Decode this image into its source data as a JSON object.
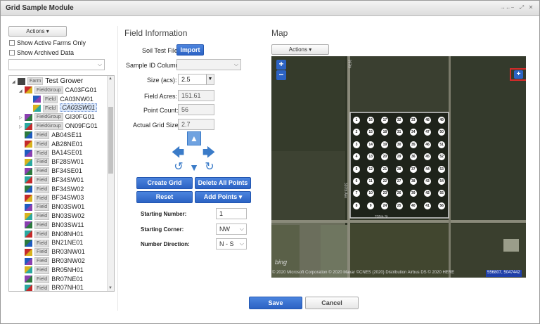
{
  "window": {
    "title": "Grid Sample Module",
    "controls": [
      "→←",
      "−",
      "⤢",
      "✕"
    ]
  },
  "left": {
    "actions_label": "Actions ▾",
    "show_active_farms": "Show Active Farms Only",
    "show_archived": "Show Archived Data",
    "tree": [
      {
        "toggle": "◢",
        "tag": "Farm",
        "label": "Test Grower",
        "indent": 14,
        "icon": "farm-icon"
      },
      {
        "toggle": "◢",
        "tag": "FieldGroup",
        "label": "CA03FG01",
        "indent": 24,
        "icon": "field-group-icon"
      },
      {
        "toggle": "",
        "tag": "Field",
        "label": "CA03NW01",
        "indent": 36,
        "icon": "field-icon"
      },
      {
        "toggle": "",
        "tag": "Field",
        "label": "CA03SW01",
        "indent": 36,
        "icon": "field-icon",
        "selected": true
      },
      {
        "toggle": "▷",
        "tag": "FieldGroup",
        "label": "GI30FG01",
        "indent": 24,
        "icon": "field-group-icon"
      },
      {
        "toggle": "▷",
        "tag": "FieldGroup",
        "label": "ON09FG01",
        "indent": 24,
        "icon": "field-group-icon"
      },
      {
        "toggle": "",
        "tag": "Field",
        "label": "AB04SE11",
        "indent": 24,
        "icon": "field-icon"
      },
      {
        "toggle": "",
        "tag": "Field",
        "label": "AB28NE01",
        "indent": 24,
        "icon": "field-icon"
      },
      {
        "toggle": "",
        "tag": "Field",
        "label": "BA14SE01",
        "indent": 24,
        "icon": "field-icon"
      },
      {
        "toggle": "",
        "tag": "Field",
        "label": "BF28SW01",
        "indent": 24,
        "icon": "field-icon"
      },
      {
        "toggle": "",
        "tag": "Field",
        "label": "BF34SE01",
        "indent": 24,
        "icon": "field-icon"
      },
      {
        "toggle": "",
        "tag": "Field",
        "label": "BF34SW01",
        "indent": 24,
        "icon": "field-icon"
      },
      {
        "toggle": "",
        "tag": "Field",
        "label": "BF34SW02",
        "indent": 24,
        "icon": "field-icon"
      },
      {
        "toggle": "",
        "tag": "Field",
        "label": "BF34SW03",
        "indent": 24,
        "icon": "field-icon"
      },
      {
        "toggle": "",
        "tag": "Field",
        "label": "BN03SW01",
        "indent": 24,
        "icon": "field-icon"
      },
      {
        "toggle": "",
        "tag": "Field",
        "label": "BN03SW02",
        "indent": 24,
        "icon": "field-icon"
      },
      {
        "toggle": "",
        "tag": "Field",
        "label": "BN03SW11",
        "indent": 24,
        "icon": "field-icon"
      },
      {
        "toggle": "",
        "tag": "Field",
        "label": "BN08NH01",
        "indent": 24,
        "icon": "field-icon"
      },
      {
        "toggle": "",
        "tag": "Field",
        "label": "BN21NE01",
        "indent": 24,
        "icon": "field-icon"
      },
      {
        "toggle": "",
        "tag": "Field",
        "label": "BR03NW01",
        "indent": 24,
        "icon": "field-icon"
      },
      {
        "toggle": "",
        "tag": "Field",
        "label": "BR03NW02",
        "indent": 24,
        "icon": "field-icon"
      },
      {
        "toggle": "",
        "tag": "Field",
        "label": "BR05NH01",
        "indent": 24,
        "icon": "field-icon"
      },
      {
        "toggle": "",
        "tag": "Field",
        "label": "BR07NE01",
        "indent": 24,
        "icon": "field-icon"
      },
      {
        "toggle": "",
        "tag": "Field",
        "label": "BR07NH01",
        "indent": 24,
        "icon": "field-icon"
      }
    ],
    "scroll_up": "▲",
    "scroll_down": "▼"
  },
  "field_info": {
    "heading": "Field Information",
    "soil_test_file_label": "Soil Test File",
    "import_label": "Import",
    "sample_id_label": "Sample ID Column:",
    "size_label": "Size (acs):",
    "size_value": "2.5",
    "field_acres_label": "Field Acres:",
    "field_acres_value": "151.61",
    "point_count_label": "Point Count:",
    "point_count_value": "56",
    "actual_grid_label": "Actual Grid Size:",
    "actual_grid_value": "2.7",
    "create_grid": "Create Grid",
    "delete_all": "Delete All Points",
    "reset": "Reset",
    "add_points": "Add Points ▾",
    "starting_number_label": "Starting Number:",
    "starting_number_value": "1",
    "starting_corner_label": "Starting Corner:",
    "starting_corner_value": "NW",
    "number_direction_label": "Number Direction:",
    "number_direction_value": "N - S"
  },
  "map": {
    "heading": "Map",
    "actions_label": "Actions ▾",
    "zoom_in": "+",
    "zoom_out": "−",
    "draw_tool": "+",
    "road_label_top": "397th",
    "road_label_side": "397th Ave",
    "road_label_bottom": "235th St",
    "attribution": "© 2020 Microsoft Corporation © 2020 Maxar ©CNES (2020) Distribution Airbus DS © 2020 HERE",
    "coords": "556807, 5047442",
    "bing": "bing",
    "grid_columns": [
      [
        1,
        2,
        3,
        4,
        5,
        6,
        7,
        8
      ],
      [
        16,
        15,
        14,
        13,
        12,
        11,
        10,
        9
      ],
      [
        17,
        18,
        19,
        20,
        21,
        22,
        23,
        24
      ],
      [
        32,
        31,
        30,
        29,
        28,
        27,
        26,
        25
      ],
      [
        33,
        34,
        35,
        36,
        37,
        38,
        39,
        40
      ],
      [
        48,
        47,
        46,
        45,
        44,
        43,
        42,
        41
      ],
      [
        49,
        50,
        51,
        52,
        53,
        54,
        55,
        56
      ]
    ]
  },
  "footer": {
    "save": "Save",
    "cancel": "Cancel"
  }
}
